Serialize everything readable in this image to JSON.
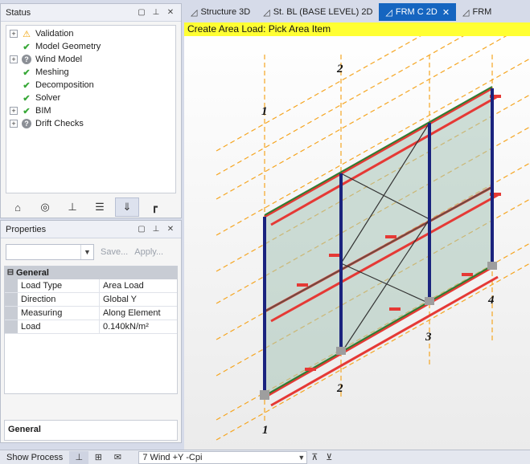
{
  "status_panel": {
    "title": "Status",
    "items": [
      {
        "label": "Validation",
        "icon": "warning-icon",
        "expandable": true
      },
      {
        "label": "Model Geometry",
        "icon": "check-icon",
        "expandable": false
      },
      {
        "label": "Wind Model",
        "icon": "question-icon",
        "expandable": true
      },
      {
        "label": "Meshing",
        "icon": "check-icon",
        "expandable": false
      },
      {
        "label": "Decomposition",
        "icon": "check-icon",
        "expandable": false
      },
      {
        "label": "Solver",
        "icon": "check-icon",
        "expandable": false
      },
      {
        "label": "BIM",
        "icon": "check-icon",
        "expandable": true
      },
      {
        "label": "Drift Checks",
        "icon": "question-icon",
        "expandable": true
      }
    ]
  },
  "properties_panel": {
    "title": "Properties",
    "save_label": "Save...",
    "apply_label": "Apply...",
    "category": "General",
    "rows": [
      {
        "name": "Load Type",
        "value": "Area Load"
      },
      {
        "name": "Direction",
        "value": "Global Y"
      },
      {
        "name": "Measuring",
        "value": "Along Element"
      },
      {
        "name": "Load",
        "value": "0.140kN/m²"
      }
    ],
    "description": "General"
  },
  "tabs": [
    {
      "label": "Structure 3D",
      "active": false
    },
    {
      "label": "St. BL (BASE LEVEL) 2D",
      "active": false
    },
    {
      "label": "FRM C 2D",
      "active": true
    },
    {
      "label": "FRM",
      "active": false
    }
  ],
  "viewport": {
    "banner": "Create Area Load: Pick Area Item",
    "grid_labels": [
      "1",
      "2",
      "1",
      "2",
      "3",
      "4"
    ]
  },
  "statusbar": {
    "show_process": "Show Process",
    "load_case": "7 Wind +Y -Cpi"
  },
  "colors": {
    "accent": "#1565c0",
    "banner": "#ffff33",
    "grid_line": "#f5a623",
    "column": "#1a237e",
    "beam_red": "#e53935",
    "panel_fill": "#a8c4b8"
  }
}
